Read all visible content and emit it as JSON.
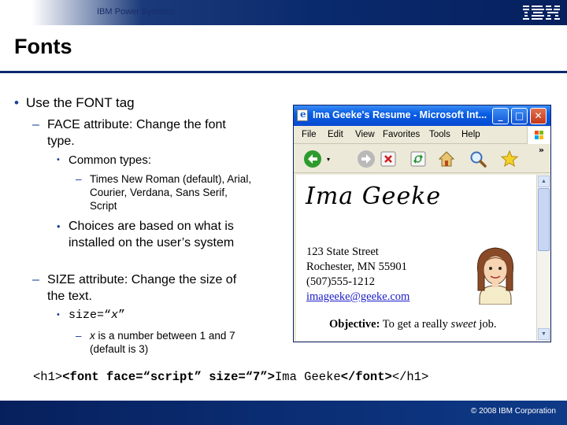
{
  "header": {
    "brand": "IBM Power Systems",
    "logo": "IBM",
    "title": "Fonts"
  },
  "bullets": {
    "b1": "Use the FONT tag",
    "face_l1": "FACE attribute:  Change the font",
    "face_l2": "type.",
    "common": "Common types:",
    "types_l1": "Times New Roman (default), Arial,",
    "types_l2": "Courier, Verdana, Sans Serif,",
    "types_l3": "Script",
    "choices_l1": "Choices are based on what is",
    "choices_l2": "installed on the user’s system",
    "size_l1": "SIZE attribute:  Change the size of",
    "size_l2": "the text.",
    "size_code_a": "size=“",
    "size_code_x": "x",
    "size_code_b": "”",
    "x_var": "x",
    "x_rest": " is a number between 1 and 7",
    "x_l2": "(default is 3)",
    "bullet_char": "•",
    "dash_char": "–"
  },
  "browser": {
    "title": "Ima Geeke's Resume - Microsoft Int...",
    "menu": [
      "File",
      "Edit",
      "View",
      "Favorites",
      "Tools",
      "Help"
    ],
    "chevron": "»",
    "name": "Ima Geeke",
    "address_lines": [
      "123 State Street",
      "Rochester, MN 55901",
      "(507)555-1212"
    ],
    "email": "imageeke@geeke.com",
    "objective_label": "Objective:",
    "objective_pre": " To get a really ",
    "objective_em": "sweet",
    "objective_post": " job."
  },
  "code": {
    "p1": "<h1>",
    "p2": "<font face=“script” size=“7”>",
    "p3": "Ima Geeke",
    "p4": "</font>",
    "p5": "</h1>"
  },
  "footer": {
    "copyright": "© 2008 IBM Corporation"
  }
}
